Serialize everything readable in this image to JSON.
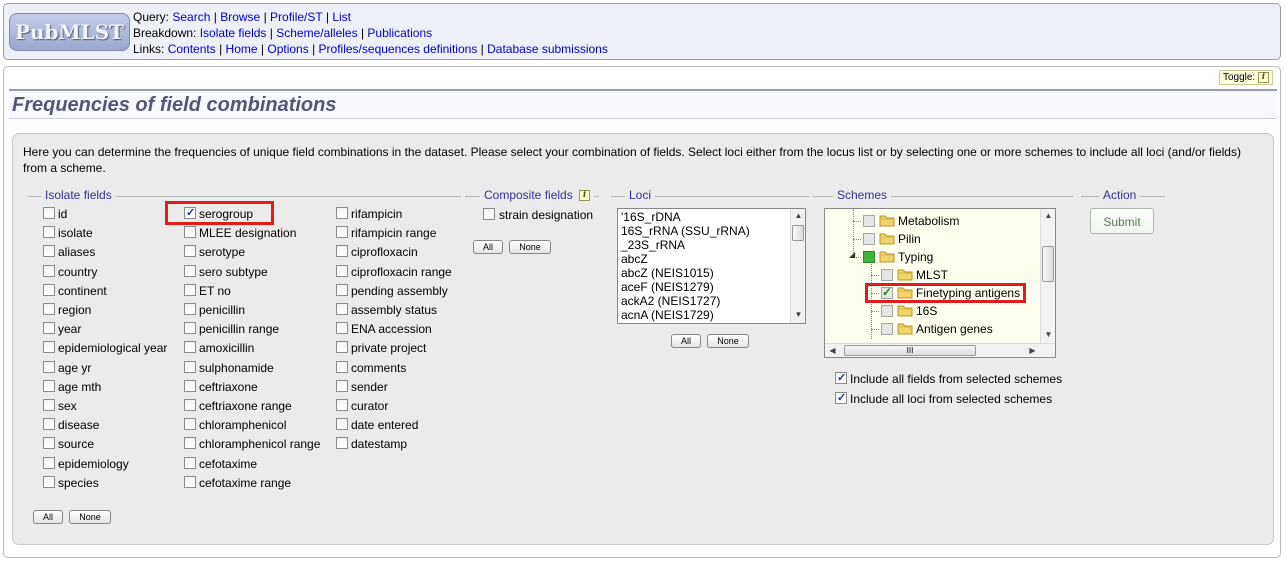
{
  "header": {
    "logo_text": "PubMLST",
    "query_prefix": "Query:",
    "query_links": [
      "Search",
      "Browse",
      "Profile/ST",
      "List"
    ],
    "breakdown_prefix": "Breakdown:",
    "breakdown_links": [
      "Isolate fields",
      "Scheme/alleles",
      "Publications"
    ],
    "links_prefix": "Links:",
    "links_links": [
      "Contents",
      "Home",
      "Options",
      "Profiles/sequences definitions",
      "Database submissions"
    ],
    "separator": "|"
  },
  "toggle": {
    "label": "Toggle:",
    "icon": "info-icon"
  },
  "page": {
    "title": "Frequencies of field combinations",
    "intro": "Here you can determine the frequencies of unique field combinations in the dataset. Please select your combination of fields. Select loci either from the locus list or by selecting one or more schemes to include all loci (and/or fields) from a scheme."
  },
  "isolate_fields": {
    "legend": "Isolate fields",
    "columns": [
      [
        {
          "label": "id",
          "checked": false
        },
        {
          "label": "isolate",
          "checked": false
        },
        {
          "label": "aliases",
          "checked": false
        },
        {
          "label": "country",
          "checked": false
        },
        {
          "label": "continent",
          "checked": false
        },
        {
          "label": "region",
          "checked": false
        },
        {
          "label": "year",
          "checked": false
        },
        {
          "label": "epidemiological year",
          "checked": false
        },
        {
          "label": "age yr",
          "checked": false
        },
        {
          "label": "age mth",
          "checked": false
        },
        {
          "label": "sex",
          "checked": false
        },
        {
          "label": "disease",
          "checked": false
        },
        {
          "label": "source",
          "checked": false
        },
        {
          "label": "epidemiology",
          "checked": false
        },
        {
          "label": "species",
          "checked": false
        }
      ],
      [
        {
          "label": "serogroup",
          "checked": true
        },
        {
          "label": "MLEE designation",
          "checked": false
        },
        {
          "label": "serotype",
          "checked": false
        },
        {
          "label": "sero subtype",
          "checked": false
        },
        {
          "label": "ET no",
          "checked": false
        },
        {
          "label": "penicillin",
          "checked": false
        },
        {
          "label": "penicillin range",
          "checked": false
        },
        {
          "label": "amoxicillin",
          "checked": false
        },
        {
          "label": "sulphonamide",
          "checked": false
        },
        {
          "label": "ceftriaxone",
          "checked": false
        },
        {
          "label": "ceftriaxone range",
          "checked": false
        },
        {
          "label": "chloramphenicol",
          "checked": false
        },
        {
          "label": "chloramphenicol range",
          "checked": false
        },
        {
          "label": "cefotaxime",
          "checked": false
        },
        {
          "label": "cefotaxime range",
          "checked": false
        }
      ],
      [
        {
          "label": "rifampicin",
          "checked": false
        },
        {
          "label": "rifampicin range",
          "checked": false
        },
        {
          "label": "ciprofloxacin",
          "checked": false
        },
        {
          "label": "ciprofloxacin range",
          "checked": false
        },
        {
          "label": "pending assembly",
          "checked": false
        },
        {
          "label": "assembly status",
          "checked": false
        },
        {
          "label": "ENA accession",
          "checked": false
        },
        {
          "label": "private project",
          "checked": false
        },
        {
          "label": "comments",
          "checked": false
        },
        {
          "label": "sender",
          "checked": false
        },
        {
          "label": "curator",
          "checked": false
        },
        {
          "label": "date entered",
          "checked": false
        },
        {
          "label": "datestamp",
          "checked": false
        }
      ]
    ],
    "all_label": "All",
    "none_label": "None"
  },
  "composite_fields": {
    "legend": "Composite fields",
    "items": [
      {
        "label": "strain designation",
        "checked": false
      }
    ],
    "all_label": "All",
    "none_label": "None"
  },
  "loci": {
    "legend": "Loci",
    "options": [
      "'16S_rDNA",
      "16S_rRNA (SSU_rRNA)",
      "_23S_rRNA",
      "abcZ",
      "abcZ (NEIS1015)",
      "aceF (NEIS1279)",
      "ackA2 (NEIS1727)",
      "acnA (NEIS1729)"
    ],
    "all_label": "All",
    "none_label": "None"
  },
  "schemes": {
    "legend": "Schemes",
    "nodes": [
      {
        "label": "Metabolism",
        "state": "unchecked"
      },
      {
        "label": "Pilin",
        "state": "unchecked"
      },
      {
        "label": "Typing",
        "state": "partial"
      },
      {
        "label": "MLST",
        "state": "unchecked"
      },
      {
        "label": "Finetyping antigens",
        "state": "checked"
      },
      {
        "label": "16S",
        "state": "unchecked"
      },
      {
        "label": "Antigen genes",
        "state": "unchecked"
      }
    ],
    "hscroll_thumb": "III",
    "include_fields": {
      "label": "Include all fields from selected schemes",
      "checked": true
    },
    "include_loci": {
      "label": "Include all loci from selected schemes",
      "checked": true
    }
  },
  "action": {
    "legend": "Action",
    "submit_label": "Submit"
  },
  "colors": {
    "highlight": "#e21c1c",
    "legend_text": "#333399",
    "title_text": "#555577",
    "link": "#0000cc"
  }
}
